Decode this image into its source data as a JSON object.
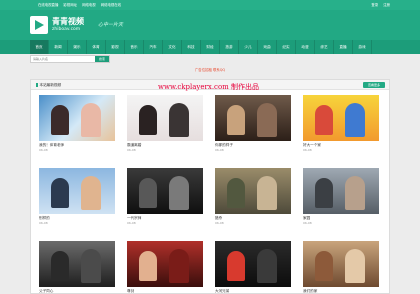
{
  "topbar": {
    "links": [
      "在线电视直播",
      "影视网址",
      "网络电视",
      "网络电视在线"
    ],
    "login": "登录",
    "register": "注册"
  },
  "header": {
    "logo_title": "青青视频",
    "logo_sub": "zhiboav.com",
    "slogan": "心中一片天"
  },
  "nav": {
    "items": [
      "首页",
      "新闻",
      "娱乐",
      "体育",
      "影视",
      "音乐",
      "汽车",
      "文化",
      "科技",
      "财经",
      "旅游",
      "少儿",
      "戏曲",
      "纪实",
      "动漫",
      "综艺",
      "直播",
      "游戏"
    ]
  },
  "search": {
    "placeholder": "请输入片名",
    "button": "搜索"
  },
  "adline": "广告位招租 联系QQ",
  "watermark": "www.ckplayerx.com 制作出品",
  "panel": {
    "title": "本站最新视频",
    "more": "查看更多"
  },
  "cards": [
    {
      "name": "我的！体育老师",
      "date": "06-08"
    },
    {
      "name": "霸道离婚",
      "date": "06-08"
    },
    {
      "name": "你那的样子",
      "date": "06-08"
    },
    {
      "name": "好大一个家",
      "date": "06-08"
    },
    {
      "name": "别样的",
      "date": "06-08"
    },
    {
      "name": "一代宗师",
      "date": "06-08"
    },
    {
      "name": "猎杀",
      "date": "06-08"
    },
    {
      "name": "家园",
      "date": "06-08"
    },
    {
      "name": "父子同心",
      "date": "06-08"
    },
    {
      "name": "尊剑",
      "date": "06-08"
    },
    {
      "name": "大河兄弟",
      "date": "06-08"
    },
    {
      "name": "我们的家",
      "date": "06-08"
    }
  ],
  "colors": {
    "brand": "#22a984",
    "nav": "#1c9d7a",
    "accent_red": "#e84a2f",
    "watermark": "#e6003a"
  }
}
